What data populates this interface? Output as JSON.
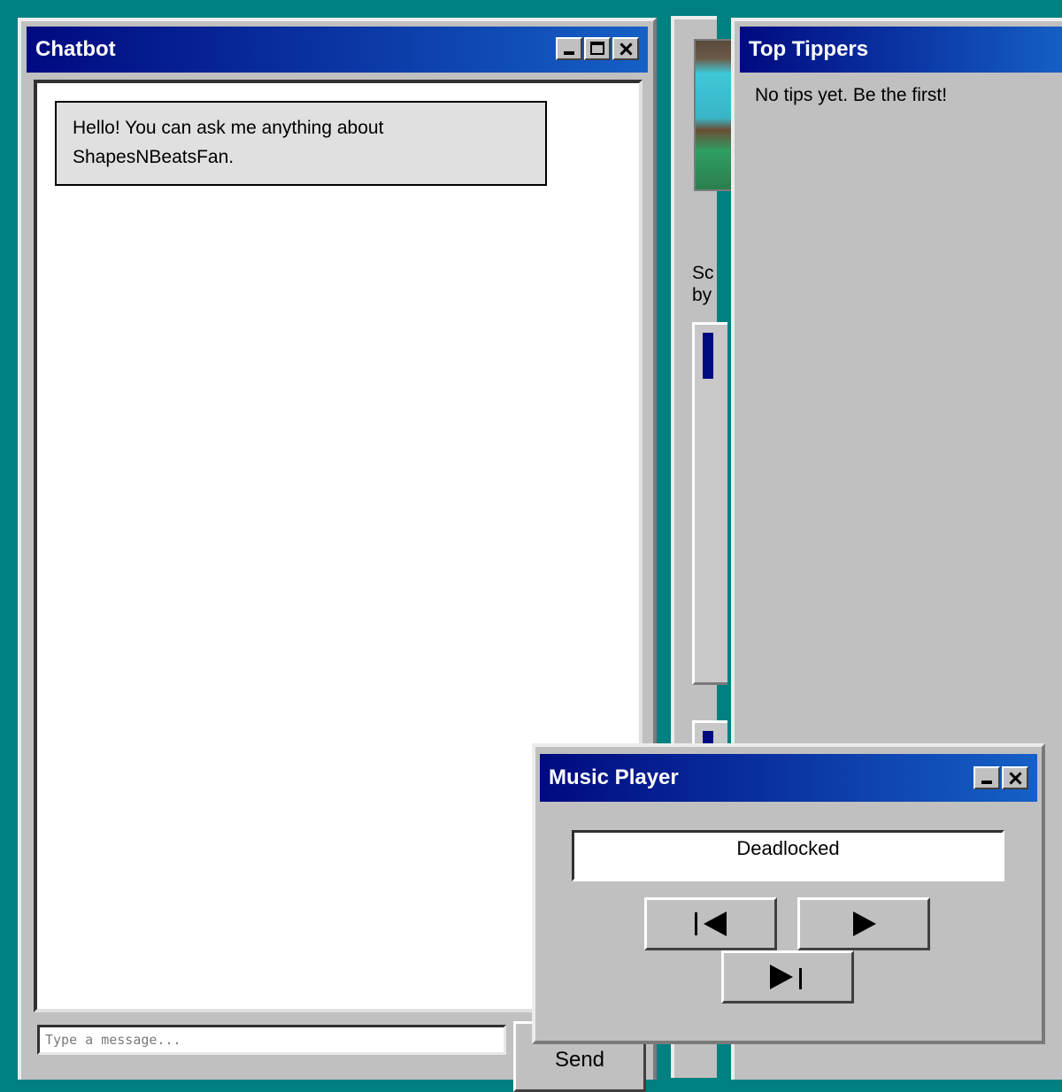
{
  "chatbot": {
    "title": "Chatbot",
    "greeting": "Hello! You can ask me anything about ShapesNBeatsFan.",
    "input_placeholder": "Type a message...",
    "send_label": "Send"
  },
  "middle_panel": {
    "text_line1": "Sc",
    "text_line2": "by"
  },
  "top_tippers": {
    "title": "Top Tippers",
    "empty_message": "No tips yet. Be the first!"
  },
  "music_player": {
    "title": "Music Player",
    "now_playing": "Deadlocked"
  },
  "icons": {
    "minimize": "minimize-icon",
    "maximize": "maximize-icon",
    "close": "close-icon",
    "previous": "previous-track-icon",
    "play": "play-icon",
    "next": "next-track-icon"
  },
  "colors": {
    "desktop": "#008080",
    "window": "#c0c0c0",
    "titlebar_start": "#000a80",
    "titlebar_end": "#1560c6"
  }
}
